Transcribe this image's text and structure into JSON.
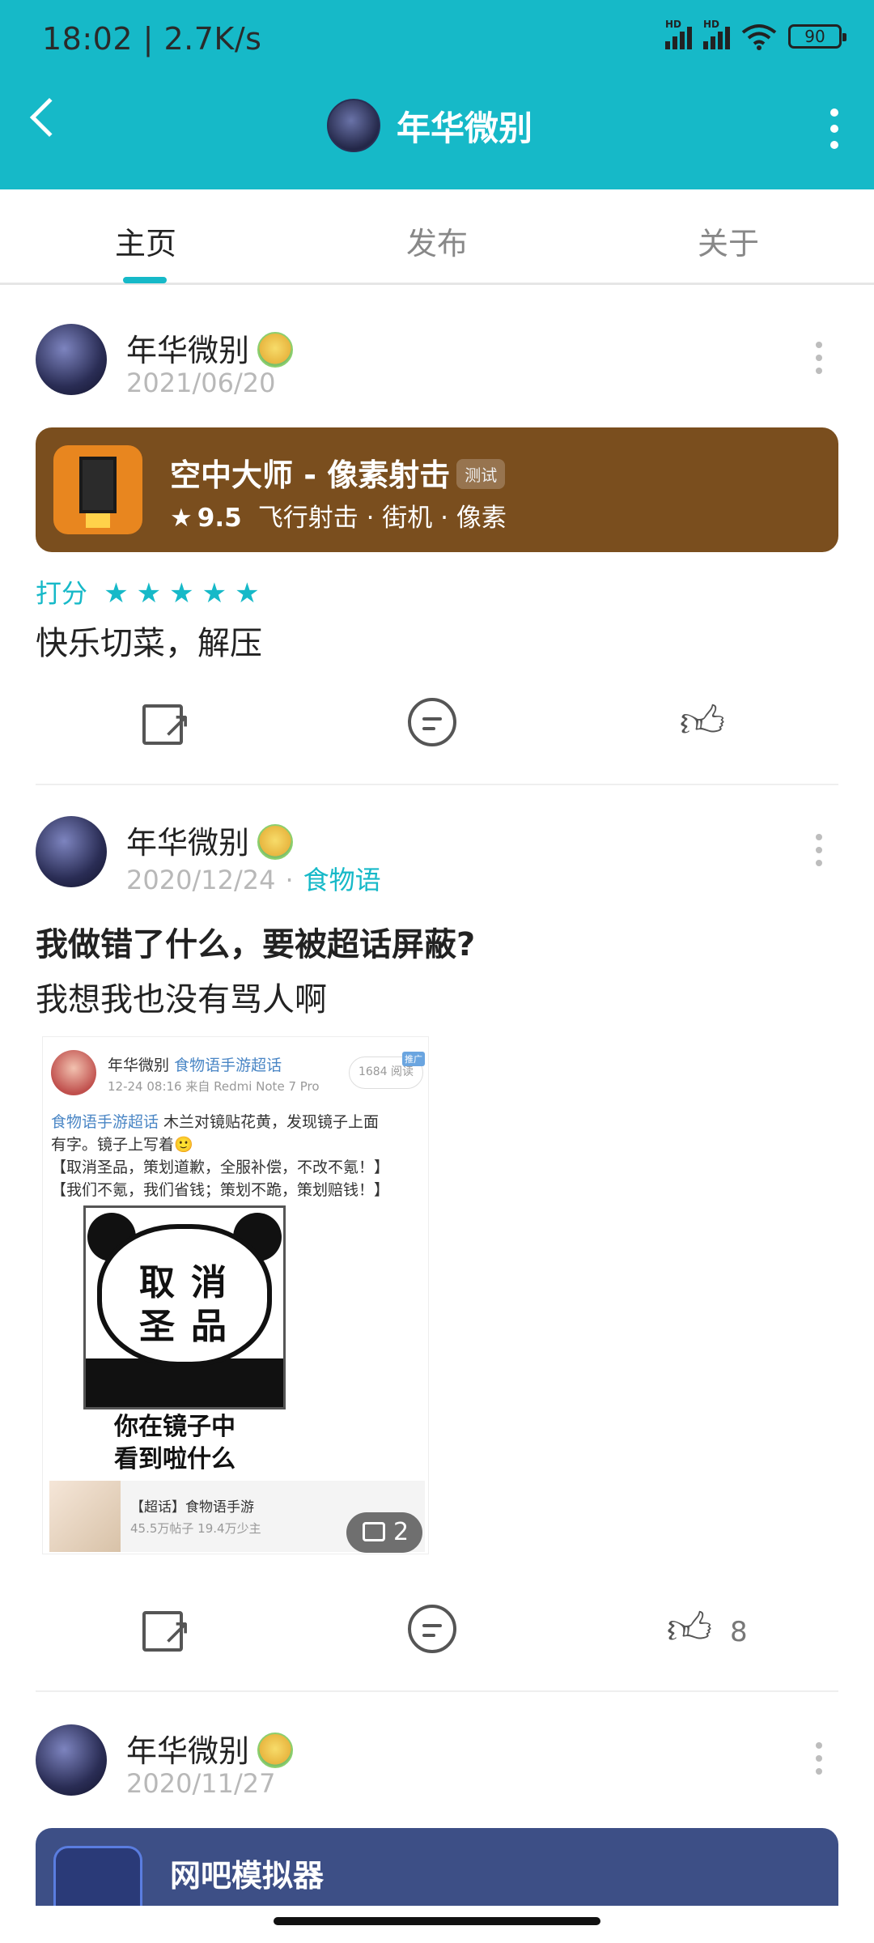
{
  "status_bar": {
    "time_speed": "18:02 | 2.7K/s",
    "network_label": "HD",
    "battery": "90"
  },
  "header": {
    "title": "年华微别"
  },
  "tabs": [
    {
      "label": "主页",
      "active": true
    },
    {
      "label": "发布",
      "active": false
    },
    {
      "label": "关于",
      "active": false
    }
  ],
  "posts": [
    {
      "author": "年华微别",
      "date": "2021/06/20",
      "game": {
        "name": "空中大师 - 像素射击",
        "tag": "测试",
        "score": "9.5",
        "genres": "飞行射击 · 街机 · 像素",
        "color": "#7a4e1e"
      },
      "rating_label": "打分",
      "stars": 5,
      "text": "快乐切菜，解压"
    },
    {
      "author": "年华微别",
      "date": "2020/12/24",
      "separator": "·",
      "topic": "食物语",
      "title": "我做错了什么，要被超话屏蔽?",
      "text": "我想我也没有骂人啊",
      "likes": "8",
      "image_count": "2",
      "screenshot": {
        "name": "年华微别",
        "super_topic": "食物语手游超话",
        "time": "12-24 08:16  来自 Redmi Note 7 Pro",
        "read_count": "1684",
        "read_label": "阅读",
        "ad_label": "推广",
        "line1_topic": "食物语手游超话",
        "line1": " 木兰对镜贴花黄，发现镜子上面",
        "line2": "有字。镜子上写着🙂",
        "line3": "【取消圣品，策划道歉，全服补偿，不改不氪！】",
        "line4": "【我们不氪，我们省钱；策划不跪，策划赔钱！】",
        "meme_text_1": "取消",
        "meme_text_2": "圣品",
        "meme_caption_1": "你在镜子中",
        "meme_caption_2": "看到啦什么",
        "topic_card_title": "【超话】食物语手游",
        "topic_card_sub": "45.5万帖子 19.4万少主"
      }
    },
    {
      "author": "年华微别",
      "date": "2020/11/27",
      "game": {
        "name": "网吧模拟器",
        "color": "#3d4f86"
      }
    }
  ],
  "colors": {
    "accent": "#16b9c8",
    "header_bg": "#16b9c8"
  }
}
